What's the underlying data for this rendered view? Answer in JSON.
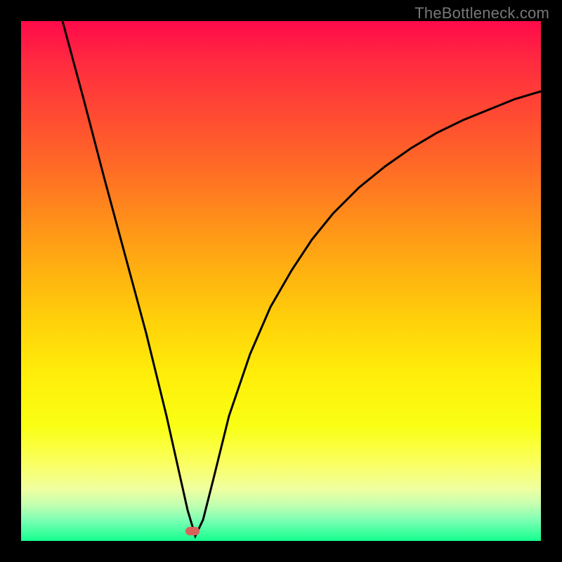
{
  "watermark": "TheBottleneck.com",
  "marker_color": "#d9635a",
  "curve_color": "#000000",
  "chart_data": {
    "type": "line",
    "title": "",
    "xlabel": "",
    "ylabel": "",
    "xlim": [
      0,
      100
    ],
    "ylim": [
      0,
      100
    ],
    "series": [
      {
        "name": "bottleneck-curve",
        "x": [
          8,
          12,
          16,
          20,
          24,
          28,
          30,
          32,
          33.5,
          35,
          37,
          40,
          44,
          48,
          52,
          56,
          60,
          65,
          70,
          75,
          80,
          85,
          90,
          95,
          100
        ],
        "y": [
          100,
          85,
          70,
          55,
          40,
          24,
          15,
          6,
          1,
          4,
          12,
          24,
          36,
          45,
          52,
          58,
          63,
          68,
          72,
          75.5,
          78.5,
          81,
          83,
          85,
          86.5
        ]
      }
    ],
    "marker": {
      "x": 33,
      "y": 1
    }
  }
}
